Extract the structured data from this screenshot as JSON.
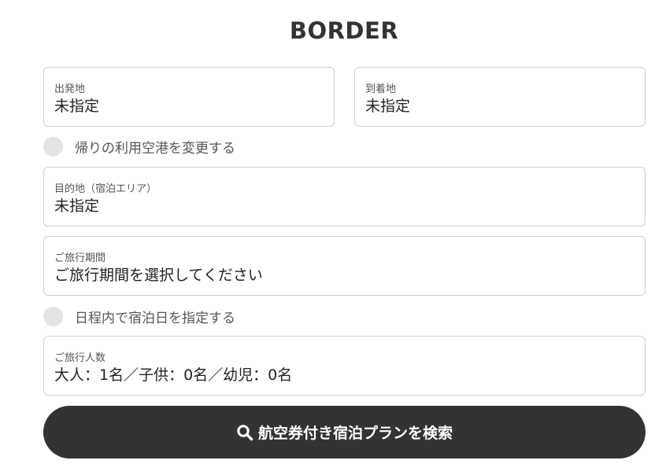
{
  "title": "BORDER",
  "origin": {
    "label": "出発地",
    "value": "未指定"
  },
  "destination_airport": {
    "label": "到着地",
    "value": "未指定"
  },
  "return_airport_toggle": {
    "label": "帰りの利用空港を変更する",
    "checked": false
  },
  "stay_destination": {
    "label": "目的地（宿泊エリア）",
    "value": "未指定"
  },
  "travel_period": {
    "label": "ご旅行期間",
    "value": "ご旅行期間を選択してください"
  },
  "stay_dates_toggle": {
    "label": "日程内で宿泊日を指定する",
    "checked": false
  },
  "travelers": {
    "label": "ご旅行人数",
    "value": "大人：1名／子供：0名／幼児：0名"
  },
  "search_button": {
    "label": "航空券付き宿泊プランを検索",
    "icon": "search-icon"
  },
  "colors": {
    "button_bg": "#333333",
    "border": "#cfcfcf",
    "checkbox": "#e3e3e3",
    "text": "#333333"
  }
}
